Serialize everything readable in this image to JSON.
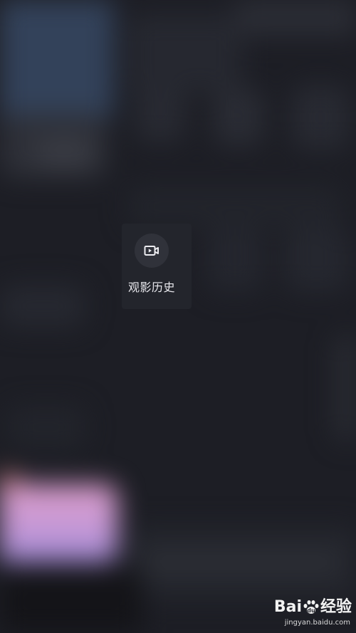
{
  "menu": {
    "item": {
      "label": "观影历史",
      "icon": "video-history-icon"
    }
  },
  "watermark": {
    "brand_left": "Bai",
    "brand_right": "经验",
    "url": "jingyan.baidu.com"
  },
  "colors": {
    "background": "#1d1e25",
    "item_background": "#23252c",
    "icon_circle": "#30323a",
    "text": "#e9e9ee"
  }
}
